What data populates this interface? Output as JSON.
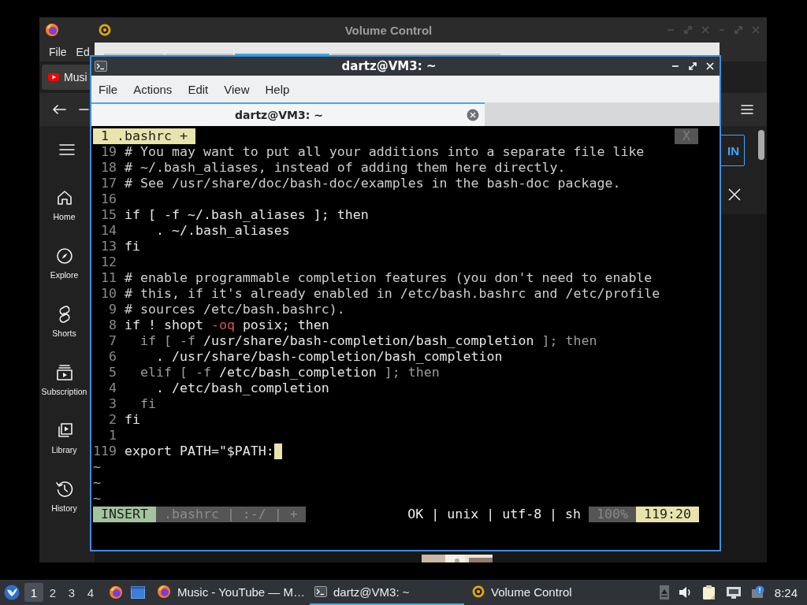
{
  "browser": {
    "menu": [
      "File",
      "Ed"
    ],
    "tab": {
      "label": "Musi"
    },
    "sidebar": [
      {
        "label": "Home"
      },
      {
        "label": "Explore"
      },
      {
        "label": "Shorts"
      },
      {
        "label": "Subscription"
      },
      {
        "label": "Library"
      },
      {
        "label": "History"
      }
    ],
    "sign_in": "IN"
  },
  "volume_control": {
    "title": "Volume Control",
    "tabs": [
      {
        "selected": false
      },
      {
        "selected": false
      },
      {
        "selected": true
      },
      {
        "selected": false
      }
    ]
  },
  "terminal": {
    "title": "dartz@VM3: ~",
    "menu": [
      "File",
      "Actions",
      "Edit",
      "View",
      "Help"
    ],
    "tabs": [
      {
        "label": "dartz@VM3: ~",
        "selected": true
      }
    ],
    "vim": {
      "tabline": {
        "label": "1 .bashrc +",
        "close": "X"
      },
      "lines": [
        {
          "number": "19",
          "cursor": false,
          "parts": [
            {
              "kind": "comment",
              "text": "# You may want to put all your additions into a separate file like"
            }
          ]
        },
        {
          "number": "18",
          "cursor": false,
          "parts": [
            {
              "kind": "comment",
              "text": "# ~/.bash_aliases, instead of adding them here directly."
            }
          ]
        },
        {
          "number": "17",
          "cursor": false,
          "parts": [
            {
              "kind": "comment",
              "text": "# See /usr/share/doc/bash-doc/examples in the bash-doc package."
            }
          ]
        },
        {
          "number": "16",
          "cursor": false
        },
        {
          "number": "15",
          "cursor": false,
          "parts": [
            {
              "kind": "code",
              "text": "if [ -f ~/.bash_aliases ]; then"
            }
          ]
        },
        {
          "number": "14",
          "cursor": false,
          "parts": [
            {
              "kind": "code",
              "text": "    . ~/.bash_aliases"
            }
          ]
        },
        {
          "number": "13",
          "cursor": false,
          "parts": [
            {
              "kind": "code",
              "text": "fi"
            }
          ]
        },
        {
          "number": "12",
          "cursor": false
        },
        {
          "number": "11",
          "cursor": false,
          "parts": [
            {
              "kind": "comment",
              "text": "# enable programmable completion features (you don't need to enable"
            }
          ]
        },
        {
          "number": "10",
          "cursor": false,
          "parts": [
            {
              "kind": "comment",
              "text": "# this, if it's already enabled in /etc/bash.bashrc and /etc/profile"
            }
          ]
        },
        {
          "number": "9",
          "cursor": false,
          "parts": [
            {
              "kind": "comment",
              "text": "# sources /etc/bash.bashrc)."
            }
          ]
        },
        {
          "number": "8",
          "cursor": false,
          "parts": [
            {
              "kind": "code",
              "text": "if ! shopt "
            },
            {
              "kind": "option",
              "text": "-oq"
            },
            {
              "kind": "code",
              "text": " posix; then"
            }
          ]
        },
        {
          "number": "7",
          "cursor": false,
          "parts": [
            {
              "kind": "keyword",
              "text": "  if [ -f "
            },
            {
              "kind": "code",
              "text": "/usr/share/bash-completion/bash_completion"
            },
            {
              "kind": "keyword",
              "text": " ]; then"
            }
          ]
        },
        {
          "number": "6",
          "cursor": false,
          "parts": [
            {
              "kind": "code",
              "text": "    . /usr/share/bash-completion/bash_completion"
            }
          ]
        },
        {
          "number": "5",
          "cursor": false,
          "parts": [
            {
              "kind": "keyword",
              "text": "  elif [ -f "
            },
            {
              "kind": "code",
              "text": "/etc/bash_completion"
            },
            {
              "kind": "keyword",
              "text": " ]; then"
            }
          ]
        },
        {
          "number": "4",
          "cursor": false,
          "parts": [
            {
              "kind": "code",
              "text": "    . /etc/bash_completion"
            }
          ]
        },
        {
          "number": "3",
          "cursor": false,
          "parts": [
            {
              "kind": "keyword",
              "text": "  fi"
            }
          ]
        },
        {
          "number": "2",
          "cursor": false,
          "parts": [
            {
              "kind": "code",
              "text": "fi"
            }
          ]
        },
        {
          "number": "1",
          "cursor": false
        },
        {
          "number": "119",
          "cursor": true,
          "parts": [
            {
              "kind": "code",
              "text": "export PATH=\"$PATH:"
            }
          ]
        }
      ],
      "fillers": [
        "~",
        "~",
        "~"
      ],
      "statusline": {
        "mode": "INSERT",
        "file": ".bashrc | :-/ | +",
        "info": "OK | unix | utf-8 | sh",
        "percent": "100%",
        "position": "119:20"
      }
    }
  },
  "taskbar": {
    "workspaces": [
      {
        "label": "1",
        "selected": true
      },
      {
        "label": "2",
        "selected": false
      },
      {
        "label": "3",
        "selected": false
      },
      {
        "label": "4",
        "selected": false
      }
    ],
    "tasks": [
      {
        "label": "Music - YouTube — M…",
        "selected": false
      },
      {
        "label": "dartz@VM3: ~",
        "selected": true
      },
      {
        "label": "Volume Control",
        "selected": false
      }
    ],
    "clock": "8:24"
  }
}
